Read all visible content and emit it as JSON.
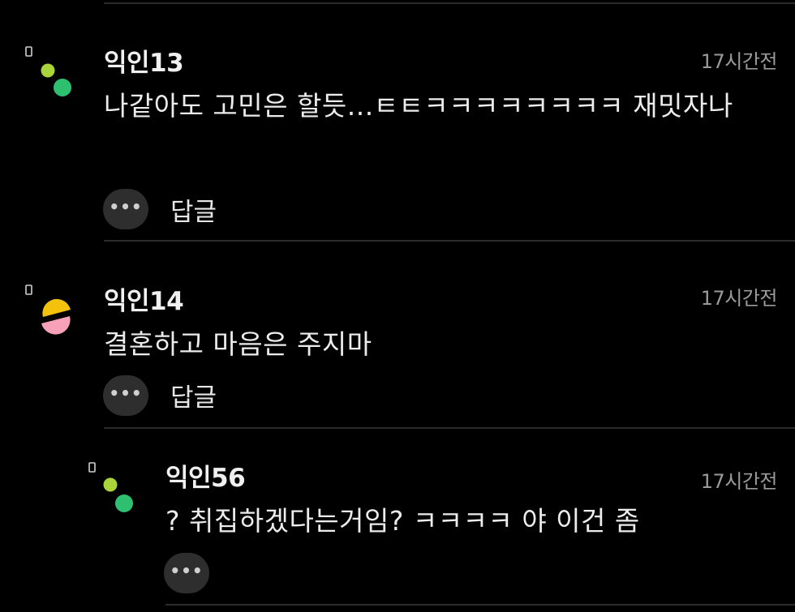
{
  "comments": [
    {
      "username": "익인13",
      "time": "17시간전",
      "text": "나같아도 고민은 할듯...ㅌㅌㅋㅋㅋㅋㅋㅋㅋㅋ 재밋자나",
      "more": "•••",
      "reply": "답글",
      "avatar": "green-dots"
    },
    {
      "username": "익인14",
      "time": "17시간전",
      "text": "결혼하고 마음은 주지마",
      "more": "•••",
      "reply": "답글",
      "avatar": "yellow-pink-halves"
    },
    {
      "username": "익인56",
      "time": "17시간전",
      "text": "? 취집하겠다는거임? ㅋㅋㅋㅋ 야 이건 좀",
      "more": "•••",
      "avatar": "green-dots"
    }
  ],
  "colors": {
    "background": "#000000",
    "divider": "#2b2b2b",
    "avatar_green_light": "#a9d43a",
    "avatar_green": "#2fbf71",
    "avatar_yellow": "#f4c20d",
    "avatar_pink": "#f7a1b8"
  }
}
